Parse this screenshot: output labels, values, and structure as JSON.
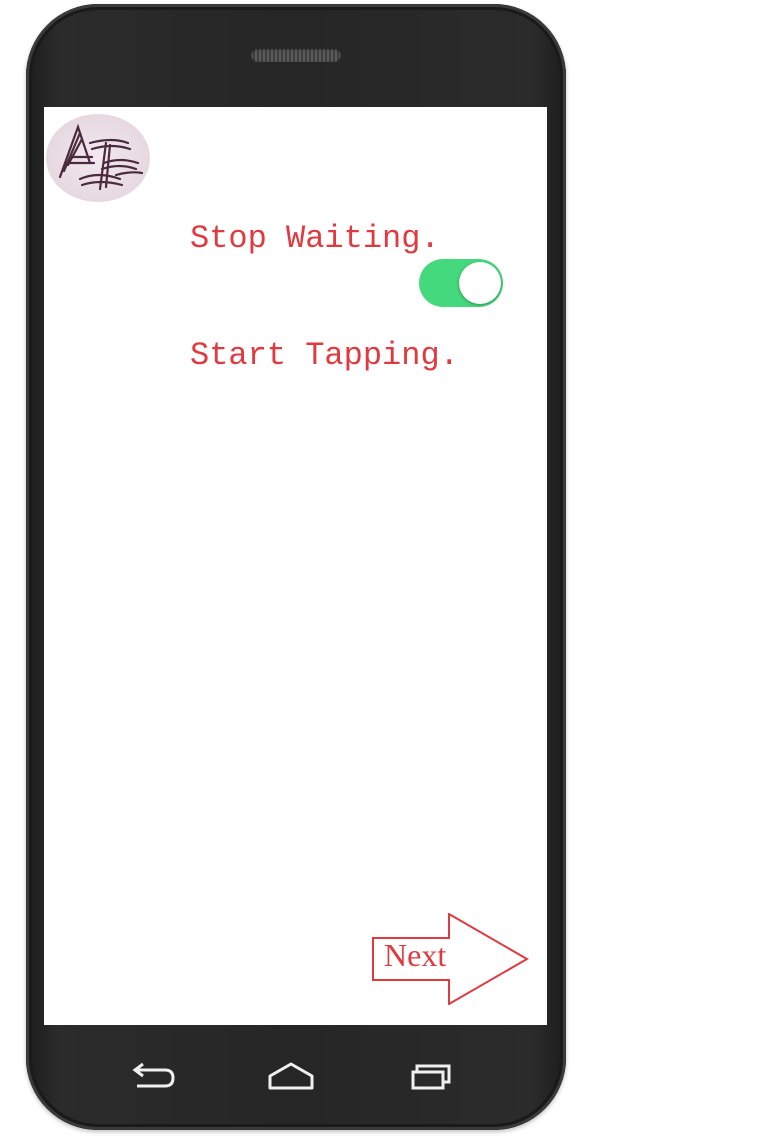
{
  "app": {
    "tagline_line1": "Stop Waiting.",
    "tagline_line2": "Start Tapping.",
    "next_label": "Next",
    "toggle_state": "on"
  },
  "colors": {
    "accent": "#e03a40",
    "toggle_on": "#45d97d",
    "device_body": "#262626"
  },
  "navbar": {
    "back_icon": "back-arrow-icon",
    "home_icon": "home-icon",
    "recent_icon": "recent-apps-icon"
  }
}
